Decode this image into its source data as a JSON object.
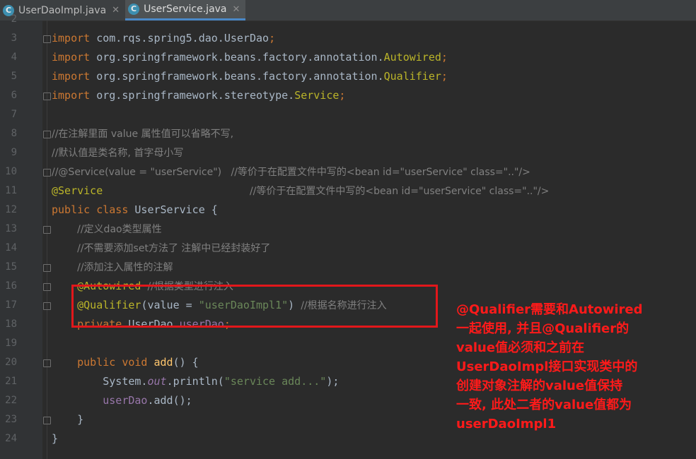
{
  "tabs": [
    {
      "label": "UserDaoImpl.java",
      "icon": "java-class-icon",
      "icon_letter": "C",
      "active": false
    },
    {
      "label": "UserService.java",
      "icon": "java-class-icon",
      "icon_letter": "C",
      "active": true
    }
  ],
  "close_glyph": "✕",
  "lines": [
    {
      "n": "2",
      "fold": false,
      "tokens": []
    },
    {
      "n": "3",
      "fold": true,
      "tokens": [
        [
          "kw",
          "import "
        ],
        [
          "",
          "com.rqs.spring5.dao.UserDao"
        ],
        [
          "kw",
          ";"
        ]
      ]
    },
    {
      "n": "4",
      "fold": false,
      "tokens": [
        [
          "kw",
          "import "
        ],
        [
          "",
          "org.springframework.beans.factory.annotation."
        ],
        [
          "ann",
          "Autowired"
        ],
        [
          "kw",
          ";"
        ]
      ]
    },
    {
      "n": "5",
      "fold": false,
      "tokens": [
        [
          "kw",
          "import "
        ],
        [
          "",
          "org.springframework.beans.factory.annotation."
        ],
        [
          "ann",
          "Qualifier"
        ],
        [
          "kw",
          ";"
        ]
      ]
    },
    {
      "n": "6",
      "fold": true,
      "tokens": [
        [
          "kw",
          "import "
        ],
        [
          "",
          "org.springframework.stereotype."
        ],
        [
          "ann",
          "Service"
        ],
        [
          "kw",
          ";"
        ]
      ]
    },
    {
      "n": "7",
      "fold": false,
      "tokens": []
    },
    {
      "n": "8",
      "fold": true,
      "tokens": [
        [
          "cm",
          "//在注解里面 value 属性值可以省略不写,"
        ]
      ]
    },
    {
      "n": "9",
      "fold": false,
      "tokens": [
        [
          "cm",
          "//默认值是类名称, 首字母小写"
        ]
      ]
    },
    {
      "n": "10",
      "fold": true,
      "tokens": [
        [
          "cm",
          "//@Service(value = \"userService\")   //等价于在配置文件中写的<bean id=\"userService\" class=\"..\"/>"
        ]
      ]
    },
    {
      "n": "11",
      "fold": false,
      "tokens": [
        [
          "ann",
          "@Service"
        ],
        [
          "",
          "                       "
        ],
        [
          "cm",
          "//等价于在配置文件中写的<bean id=\"userService\" class=\"..\"/>"
        ]
      ]
    },
    {
      "n": "12",
      "fold": false,
      "tokens": [
        [
          "kw",
          "public class "
        ],
        [
          "",
          "UserService {"
        ]
      ]
    },
    {
      "n": "13",
      "fold": true,
      "tokens": [
        [
          "",
          "    "
        ],
        [
          "cm",
          "//定义dao类型属性"
        ]
      ]
    },
    {
      "n": "14",
      "fold": false,
      "tokens": [
        [
          "",
          "    "
        ],
        [
          "cm",
          "//不需要添加set方法了 注解中已经封装好了"
        ]
      ]
    },
    {
      "n": "15",
      "fold": true,
      "tokens": [
        [
          "",
          "    "
        ],
        [
          "cm",
          "//添加注入属性的注解"
        ]
      ]
    },
    {
      "n": "16",
      "fold": true,
      "tokens": [
        [
          "",
          "    "
        ],
        [
          "ann",
          "@Autowired "
        ],
        [
          "cm",
          "//根据类型进行注入"
        ]
      ]
    },
    {
      "n": "17",
      "fold": true,
      "tokens": [
        [
          "",
          "    "
        ],
        [
          "ann",
          "@Qualifier"
        ],
        [
          "",
          "(value = "
        ],
        [
          "str",
          "\"userDaoImpl1\""
        ],
        [
          "",
          ") "
        ],
        [
          "cm",
          "//根据名称进行注入"
        ]
      ]
    },
    {
      "n": "18",
      "fold": false,
      "tokens": [
        [
          "",
          "    "
        ],
        [
          "kw",
          "private "
        ],
        [
          "",
          "UserDao "
        ],
        [
          "fld",
          "userDao"
        ],
        [
          "kw",
          ";"
        ]
      ]
    },
    {
      "n": "19",
      "fold": false,
      "tokens": []
    },
    {
      "n": "20",
      "fold": true,
      "tokens": [
        [
          "",
          "    "
        ],
        [
          "kw",
          "public void "
        ],
        [
          "mth",
          "add"
        ],
        [
          "",
          "() {"
        ]
      ]
    },
    {
      "n": "21",
      "fold": false,
      "tokens": [
        [
          "",
          "        System."
        ],
        [
          "ital",
          "out"
        ],
        [
          "",
          ".println("
        ],
        [
          "str",
          "\"service add...\""
        ],
        [
          "",
          ");"
        ]
      ]
    },
    {
      "n": "22",
      "fold": false,
      "tokens": [
        [
          "",
          "        "
        ],
        [
          "fld",
          "userDao"
        ],
        [
          "",
          ".add();"
        ]
      ]
    },
    {
      "n": "23",
      "fold": true,
      "tokens": [
        [
          "",
          "    }"
        ]
      ]
    },
    {
      "n": "24",
      "fold": false,
      "tokens": [
        [
          "",
          "}"
        ]
      ]
    }
  ],
  "annotation": {
    "lines": [
      "@Qualifier需要和Autowired",
      "一起使用, 并且@Qualifier的",
      "value值必须和之前在",
      "UserDaoImpl接口实现类中的",
      "创建对象注解的value值保持",
      "一致, 此处二者的value值都为",
      "userDaoImpl1"
    ],
    "color": "#ff1a1a"
  },
  "colors": {
    "keyword": "#cc7832",
    "annotation": "#bbb529",
    "comment": "#808080",
    "string": "#6a8759",
    "field": "#9876aa",
    "method": "#ffc66d",
    "highlight_border": "#e2171b"
  }
}
